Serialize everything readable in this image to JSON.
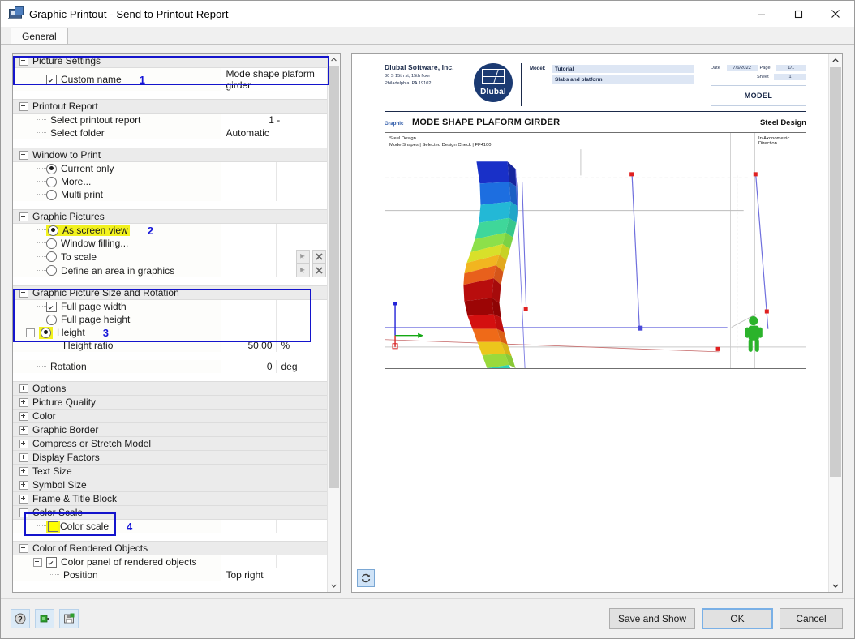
{
  "window": {
    "title": "Graphic Printout - Send to Printout Report",
    "icon": "printout-window-icon",
    "minimize": "minimize-icon",
    "maximize": "maximize-icon",
    "close": "close-icon"
  },
  "tabs": [
    {
      "label": "General",
      "active": true
    }
  ],
  "settings": {
    "groups": [
      {
        "name": "Picture Settings",
        "expanded": true,
        "rows": [
          {
            "control": "checkbox",
            "checked": true,
            "label": "Custom name",
            "marker": "1",
            "value": "Mode shape plaform girder",
            "value_highlight": true,
            "value_align": "left"
          }
        ]
      },
      {
        "name": "Printout Report",
        "expanded": true,
        "rows": [
          {
            "control": "none",
            "label": "Select printout report",
            "value": "1 -",
            "value_align": "center"
          },
          {
            "control": "none",
            "label": "Select folder",
            "value": "Automatic",
            "value_align": "left"
          }
        ]
      },
      {
        "name": "Window to Print",
        "expanded": true,
        "rows": [
          {
            "control": "radio",
            "checked": true,
            "label": "Current only"
          },
          {
            "control": "radio",
            "checked": false,
            "label": "More..."
          },
          {
            "control": "radio",
            "checked": false,
            "label": "Multi print"
          }
        ]
      },
      {
        "name": "Graphic Pictures",
        "expanded": true,
        "rows": [
          {
            "control": "radio",
            "checked": true,
            "label": "As screen view",
            "label_highlight": true,
            "marker": "2"
          },
          {
            "control": "radio",
            "checked": false,
            "label": "Window filling..."
          },
          {
            "control": "radio",
            "checked": false,
            "label": "To scale",
            "buttons": [
              "pick-icon",
              "delete-icon"
            ]
          },
          {
            "control": "radio",
            "checked": false,
            "label": "Define an area in graphics",
            "buttons": [
              "pick-icon",
              "delete-icon"
            ]
          }
        ]
      },
      {
        "name": "Graphic Picture Size and Rotation",
        "expanded": true,
        "rows": [
          {
            "control": "checkbox",
            "checked": true,
            "label": "Full page width"
          },
          {
            "control": "radio",
            "checked": false,
            "label": "Full page height"
          },
          {
            "control": "radio",
            "checked": true,
            "label": "Height",
            "control_highlight": true,
            "twisty": true,
            "marker": "3"
          },
          {
            "control": "none",
            "label": "Height ratio",
            "indent": 2,
            "value": "50.00",
            "unit": "%",
            "value_highlight": true,
            "value_align": "right"
          },
          {
            "control": "none",
            "label": "Rotation",
            "spacer_before": true,
            "value": "0",
            "unit": "deg",
            "value_align": "right"
          }
        ]
      }
    ],
    "collapsed_groups": [
      "Options",
      "Picture Quality",
      "Color",
      "Graphic Border",
      "Compress or Stretch Model",
      "Display Factors",
      "Text Size",
      "Symbol Size",
      "Frame & Title Block"
    ],
    "color_scale_group": {
      "name": "Color Scale",
      "expanded": true,
      "rows": [
        {
          "control": "yellowbox",
          "label": "Color scale",
          "marker": "4"
        }
      ]
    },
    "rendered_group": {
      "name": "Color of Rendered Objects",
      "expanded": true,
      "rows": [
        {
          "control": "checkbox",
          "checked": true,
          "label": "Color panel of rendered objects",
          "twisty": true
        },
        {
          "control": "none",
          "label": "Position",
          "indent": 2,
          "value": "Top right",
          "value_align": "left"
        }
      ]
    },
    "callout_color": "#1414cc"
  },
  "preview": {
    "refresh_icon": "refresh-icon",
    "scroll_up_icon": "chevron-up-icon",
    "scroll_down_icon": "chevron-down-icon",
    "company": {
      "name": "Dlubal Software, Inc.",
      "address_line1": "30 S 15th st, 15th floor",
      "address_line2": "Philadelphia, PA 19102",
      "logo_text": "Dlubal"
    },
    "model_fields": [
      {
        "key": "Model:",
        "value": "Tutorial"
      },
      {
        "key": "",
        "value": "Slabs and platform"
      }
    ],
    "meta": [
      {
        "key": "Date",
        "value": "7/6/2022"
      },
      {
        "key": "Page",
        "value": "1/1"
      },
      {
        "key": "Sheet",
        "value": "1"
      }
    ],
    "model_box": "MODEL",
    "graphic_tag": "Graphic",
    "graphic_title": "MODE SHAPE PLAFORM GIRDER",
    "graphic_right": "Steel Design",
    "canvas_note1": "Steel Design",
    "canvas_note2": "Mode Shapes | Selected Design Check | FF4100",
    "canvas_note3": "In Axonometric Direction"
  },
  "footer": {
    "tools": [
      {
        "name": "help-icon",
        "title": "Help"
      },
      {
        "name": "settings-apply-icon",
        "title": "Settings"
      },
      {
        "name": "save-settings-icon",
        "title": "Save"
      }
    ],
    "buttons": [
      {
        "label": "Save and Show",
        "primary": false
      },
      {
        "label": "OK",
        "primary": true
      },
      {
        "label": "Cancel",
        "primary": false
      }
    ]
  }
}
